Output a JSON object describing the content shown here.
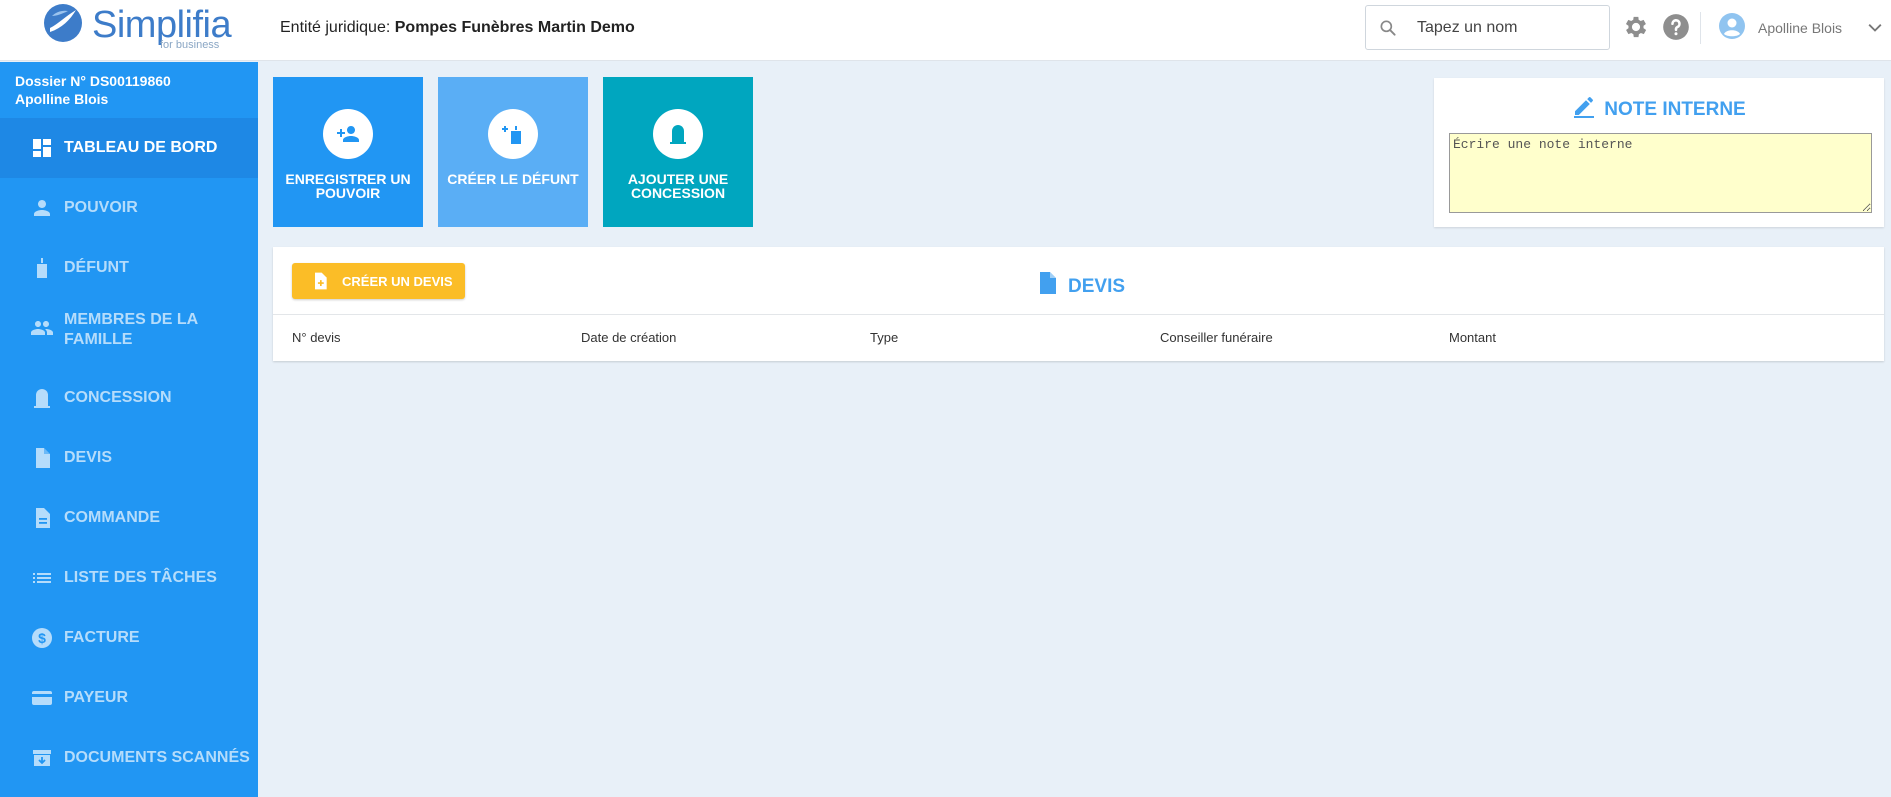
{
  "header": {
    "logo_text": "Simplifia",
    "logo_sub": "for business",
    "entity_label": "Entité juridique:",
    "entity_name": "Pompes Funèbres Martin Demo",
    "search_placeholder": "Tapez un nom",
    "user_name": "Apolline Blois"
  },
  "sidebar": {
    "dossier_number": "Dossier N° DS00119860",
    "dossier_client": "Apolline Blois",
    "items": [
      {
        "label": "TABLEAU DE BORD",
        "icon": "dashboard-icon",
        "active": true
      },
      {
        "label": "POUVOIR",
        "icon": "person-icon"
      },
      {
        "label": "DÉFUNT",
        "icon": "candle-icon"
      },
      {
        "label": "MEMBRES DE LA FAMILLE",
        "icon": "people-icon"
      },
      {
        "label": "CONCESSION",
        "icon": "tombstone-icon"
      },
      {
        "label": "DEVIS",
        "icon": "document-icon"
      },
      {
        "label": "COMMANDE",
        "icon": "order-icon"
      },
      {
        "label": "LISTE DES TÂCHES",
        "icon": "list-icon"
      },
      {
        "label": "FACTURE",
        "icon": "dollar-icon"
      },
      {
        "label": "PAYEUR",
        "icon": "credit-card-icon"
      },
      {
        "label": "DOCUMENTS SCANNÉS",
        "icon": "archive-icon"
      }
    ]
  },
  "tiles": [
    {
      "label": "ENREGISTRER UN POUVOIR",
      "color": "#2196f3",
      "icon": "add-person-icon"
    },
    {
      "label": "CRÉER LE DÉFUNT",
      "color": "#5aaef5",
      "icon": "add-candle-icon"
    },
    {
      "label": "AJOUTER UNE CONCESSION",
      "color": "#00a6bf",
      "icon": "tombstone-icon"
    }
  ],
  "note": {
    "title": "NOTE INTERNE",
    "placeholder": "Écrire une note interne"
  },
  "devis": {
    "create_button": "CRÉER UN DEVIS",
    "title": "DEVIS",
    "columns": [
      "N° devis",
      "Date de création",
      "Type",
      "Conseiller funéraire",
      "Montant"
    ]
  },
  "colors": {
    "primary": "#2196f3",
    "accent": "#fbbd27",
    "title_blue": "#42a0ef"
  }
}
